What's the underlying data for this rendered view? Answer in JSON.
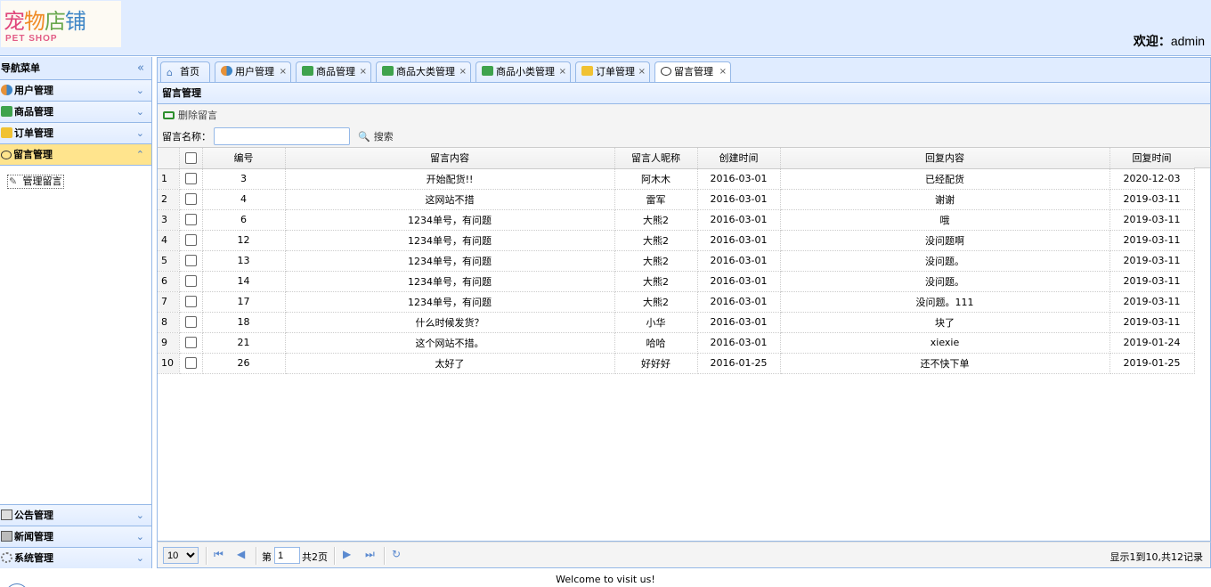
{
  "header": {
    "logo_cn": "宠物店铺",
    "logo_en": "PET SHOP",
    "welcome_prefix": "欢迎：",
    "username": "admin"
  },
  "nav": {
    "title": "导航菜单",
    "collapse_glyph": "«",
    "top_items": [
      {
        "label": "用户管理",
        "icon": "users-icon"
      },
      {
        "label": "商品管理",
        "icon": "list-icon"
      },
      {
        "label": "订单管理",
        "icon": "order-icon"
      },
      {
        "label": "留言管理",
        "icon": "comment-icon"
      }
    ],
    "leaf": "管理留言",
    "bottom_items": [
      {
        "label": "公告管理",
        "icon": "notice-icon"
      },
      {
        "label": "新闻管理",
        "icon": "news-icon"
      },
      {
        "label": "系统管理",
        "icon": "gear-icon"
      }
    ]
  },
  "tabs": [
    {
      "label": "首页",
      "icon": "home-icon",
      "closable": false
    },
    {
      "label": "用户管理",
      "icon": "users-icon",
      "closable": true
    },
    {
      "label": "商品管理",
      "icon": "list-icon",
      "closable": true
    },
    {
      "label": "商品大类管理",
      "icon": "list-icon",
      "closable": true
    },
    {
      "label": "商品小类管理",
      "icon": "list-icon",
      "closable": true
    },
    {
      "label": "订单管理",
      "icon": "order-icon",
      "closable": true
    },
    {
      "label": "留言管理",
      "icon": "comment-icon",
      "closable": true
    }
  ],
  "panel": {
    "title": "留言管理",
    "delete_label": "删除留言",
    "search_label": "留言名称：",
    "search_value": "",
    "search_button": "搜索"
  },
  "grid": {
    "columns": [
      "编号",
      "留言内容",
      "留言人昵称",
      "创建时间",
      "回复内容",
      "回复时间"
    ],
    "rows": [
      [
        "1",
        "3",
        "开始配货!!",
        "阿木木",
        "2016-03-01",
        "已经配货",
        "2020-12-03"
      ],
      [
        "2",
        "4",
        "这网站不措",
        "雷军",
        "2016-03-01",
        "谢谢",
        "2019-03-11"
      ],
      [
        "3",
        "6",
        "1234单号，有问题",
        "大熊2",
        "2016-03-01",
        "哦",
        "2019-03-11"
      ],
      [
        "4",
        "12",
        "1234单号，有问题",
        "大熊2",
        "2016-03-01",
        "没问题啊",
        "2019-03-11"
      ],
      [
        "5",
        "13",
        "1234单号，有问题",
        "大熊2",
        "2016-03-01",
        "没问题。",
        "2019-03-11"
      ],
      [
        "6",
        "14",
        "1234单号，有问题",
        "大熊2",
        "2016-03-01",
        "没问题。",
        "2019-03-11"
      ],
      [
        "7",
        "17",
        "1234单号，有问题",
        "大熊2",
        "2016-03-01",
        "没问题。111",
        "2019-03-11"
      ],
      [
        "8",
        "18",
        "什么时候发货？",
        "小华",
        "2016-03-01",
        "块了",
        "2019-03-11"
      ],
      [
        "9",
        "21",
        "这个网站不措。",
        "哈哈",
        "2016-03-01",
        "xiexie",
        "2019-01-24"
      ],
      [
        "10",
        "26",
        "太好了",
        "好好好",
        "2016-01-25",
        "还不快下单",
        "2019-01-25"
      ]
    ]
  },
  "pager": {
    "page_size": "10",
    "page_prefix": "第",
    "page_value": "1",
    "page_total": "共2页",
    "info": "显示1到10,共12记录"
  },
  "footer": {
    "text": "Welcome to visit us!"
  }
}
